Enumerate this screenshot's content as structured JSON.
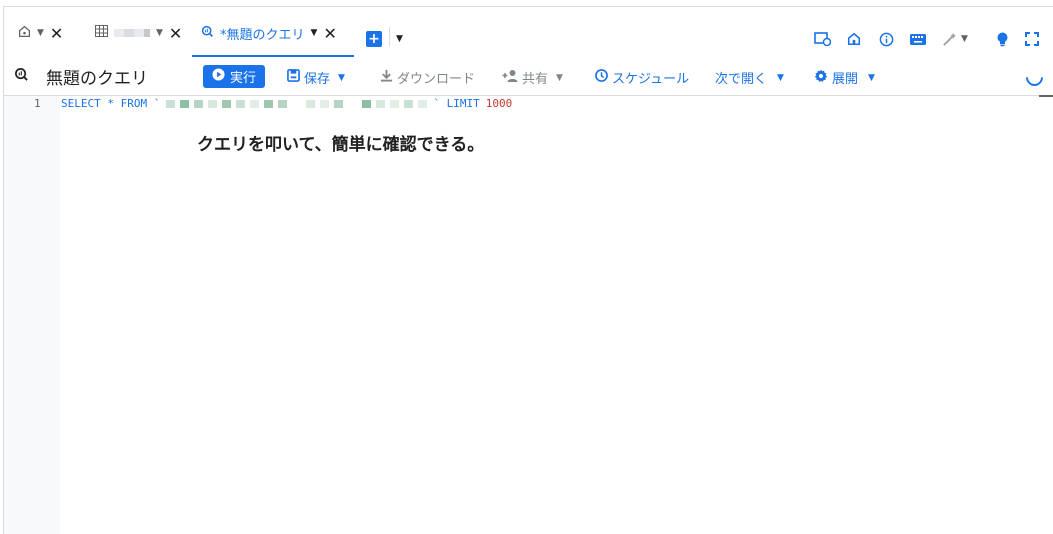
{
  "tabs": [
    {
      "label": "",
      "icon": "home-icon"
    },
    {
      "label": "",
      "icon": "table-icon"
    },
    {
      "label": "*無題のクエリ",
      "icon": "query-icon",
      "active": true
    }
  ],
  "toolbar": {
    "title": "無題のクエリ",
    "run_label": "実行",
    "save_label": "保存",
    "download_label": "ダウンロード",
    "share_label": "共有",
    "schedule_label": "スケジュール",
    "open_with_label": "次で開く",
    "expand_label": "展開"
  },
  "editor": {
    "line_number": "1",
    "sql_select": "SELECT * FROM `",
    "sql_limit_kw": "` LIMIT",
    "sql_limit_value": "1000"
  },
  "annotation": "クエリを叩いて、簡単に確認できる。",
  "colors": {
    "accent": "#1a73e8",
    "number": "#c0392b"
  }
}
